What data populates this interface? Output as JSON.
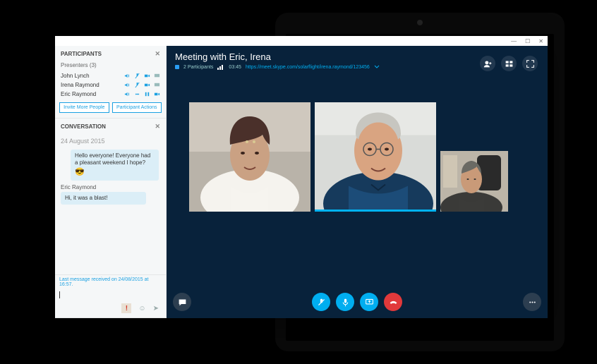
{
  "meeting": {
    "title": "Meeting with Eric, Irena",
    "participants_label": "2 Participants",
    "duration": "03:45",
    "url": "https://meet.skype.com/solarflight/irena.raymond/123456"
  },
  "window_controls": {
    "min": "—",
    "max": "☐",
    "close": "✕"
  },
  "head_buttons": {
    "add_person": "add-person",
    "layout": "layout-grid",
    "fullscreen": "fullscreen"
  },
  "sidebar": {
    "participants_title": "PARTICIPANTS",
    "presenters_label": "Presenters (3)",
    "presenters": [
      {
        "name": "John Lynch"
      },
      {
        "name": "Irena Raymond"
      },
      {
        "name": "Eric Raymond"
      }
    ],
    "invite_btn": "Invite More People",
    "actions_btn": "Participant Actions",
    "conversation_title": "CONVERSATION",
    "date": "24 August 2015",
    "messages": [
      {
        "sender": null,
        "text": "Hello everyone! Everyone had a pleasant weekend I hope?",
        "emoji": "😎"
      },
      {
        "sender": "Eric Raymond",
        "text": "Hi, it was a blast!"
      }
    ],
    "last_received": "Last message received on 24/08/2015 at 16:57.",
    "input_tools": {
      "priority": "!",
      "emoji": "☺",
      "send": "➤"
    }
  },
  "bottom": {
    "chat": "chat",
    "mic_muted": "mic-muted",
    "mic": "mic",
    "present": "present-screen",
    "hangup": "hangup",
    "more": "more"
  }
}
